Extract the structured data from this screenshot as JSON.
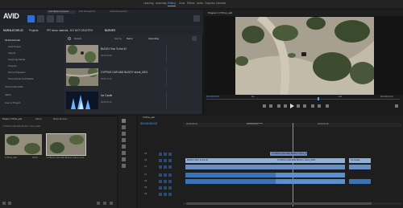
{
  "top_menu": {
    "items": [
      "Learning",
      "Assembly",
      "Editing",
      "Color",
      "Effects",
      "Audio",
      "Graphics",
      "Libraries"
    ],
    "active_index": 2
  },
  "avid": {
    "logo": "AVID",
    "window_tabs": [
      "Avid Media Composer",
      "Avid File Explorer",
      "Audio File Explorer"
    ],
    "breadcrumb": [
      "MURALEGHE-02",
      "Projects",
      "PPI demo material - DO NOT DELETE!!!",
      "BUSHES"
    ],
    "filter": {
      "view": "Default",
      "sort_label": "Sort by",
      "sort_field": "Name",
      "sort_order": "Ascending"
    },
    "tree": [
      "MURALEGHE",
      "Avid Project",
      "Clients",
      "Incoming Media",
      "Projects",
      "Sort & Playback",
      "Promotional Avid Media",
      "Avid media folder",
      "Alpha",
      "User & Project"
    ],
    "tree_selected_index": 0,
    "clips": [
      {
        "name": "BUGGY Run To the ID",
        "meta": "00:00:04:09"
      },
      {
        "name": "CYPRUS CAR AND BUGGY shoot_0001",
        "meta": "00:00:11:22"
      },
      {
        "name": "Ice Castle",
        "meta": "00:00:02:12"
      }
    ]
  },
  "program": {
    "tab": "Program: CYPrus_edit",
    "timecode_left": "00:00:06:02",
    "fit": "Fit",
    "fraction": "1/2",
    "timecode_right": "00:00:24:14"
  },
  "project": {
    "tabs": [
      "Project: CYPrus_edit",
      "Effects",
      "Media Browser"
    ],
    "path": "CYPRUS CAR AND BUGGY shoot_0001",
    "clips": [
      {
        "name": "CYPrus_edit",
        "duration": "00:00"
      },
      {
        "name": "CYPRUS CAR AND BUGGY shoot_0001",
        "duration": "11:22"
      }
    ]
  },
  "timeline": {
    "tab": "CYPrus_edit",
    "timecode": "00:00:06:02",
    "ruler": [
      "00:00:05:00",
      "00:00:10:00",
      "00:00:15:00"
    ],
    "tracks": [
      "V3",
      "V2",
      "V1",
      "A1",
      "A2",
      "A3",
      "A4"
    ],
    "clip_labels": [
      "CYPRUS CAR AND BUGGY shoot_0001",
      "BUGGY Run To the ID",
      "CYPRUS CAR AND BUGGY shoot_0001",
      "Ice Castle"
    ]
  },
  "colors": {
    "accent": "#4fa3ff",
    "avid_blue": "#2c6fd6",
    "video_clip": "#8fb0d8",
    "audio_clip": "#3a73b8"
  }
}
